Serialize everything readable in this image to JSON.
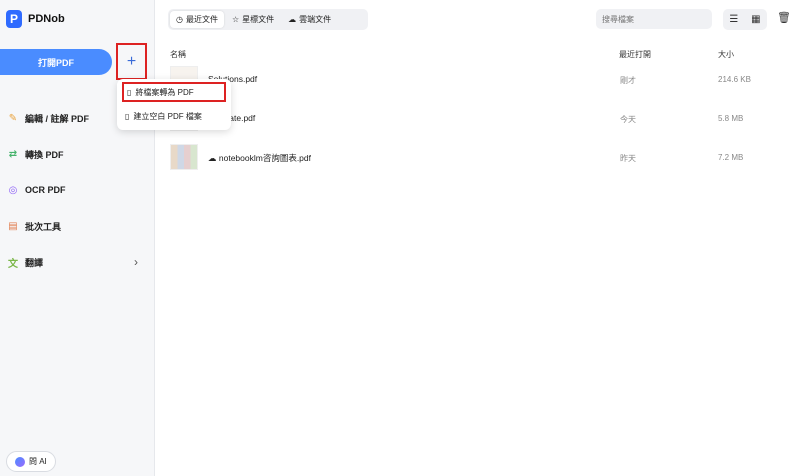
{
  "app": {
    "name": "PDNob",
    "logo": "P"
  },
  "sidebar": {
    "open_button": "打開PDF",
    "plus_label": "+",
    "items": [
      {
        "label": "編輯 / 註解 PDF",
        "icon": "edit-icon",
        "glyph": "✎",
        "color": "#e9a23b"
      },
      {
        "label": "轉換 PDF",
        "icon": "convert-icon",
        "glyph": "⇄",
        "color": "#45b36b"
      },
      {
        "label": "OCR PDF",
        "icon": "ocr-icon",
        "glyph": "◎",
        "color": "#8a5cf6"
      },
      {
        "label": "批次工具",
        "icon": "batch-icon",
        "glyph": "▤",
        "color": "#e07a4a"
      },
      {
        "label": "翻譯",
        "icon": "translate-icon",
        "glyph": "文",
        "color": "#7ab648",
        "chevron": "›"
      }
    ],
    "ask_ai": "問 AI"
  },
  "popup": {
    "items": [
      {
        "label": "將檔案轉為 PDF",
        "icon": "file-convert-icon"
      },
      {
        "label": "建立空白 PDF 檔案",
        "icon": "file-new-icon"
      }
    ]
  },
  "tabs": [
    {
      "label": "最近文件",
      "icon": "clock-icon",
      "glyph": "◷"
    },
    {
      "label": "星標文件",
      "icon": "star-icon",
      "glyph": "☆"
    },
    {
      "label": "雲端文件",
      "icon": "cloud-icon",
      "glyph": "☁"
    }
  ],
  "search": {
    "placeholder": "搜尋檔案"
  },
  "table": {
    "headers": {
      "name": "名稱",
      "date": "最近打開",
      "size": "大小"
    },
    "rows": [
      {
        "name": "Solutions.pdf",
        "date": "剛才",
        "size": "214.6 KB",
        "cloud": ""
      },
      {
        "name": "e_create.pdf",
        "date": "今天",
        "size": "5.8 MB",
        "cloud": ""
      },
      {
        "name": "notebooklm咨詢圖表.pdf",
        "date": "昨天",
        "size": "7.2 MB",
        "cloud": "☁"
      }
    ]
  },
  "colors": {
    "accent": "#4a8cff",
    "highlight_border": "#dd2222"
  }
}
